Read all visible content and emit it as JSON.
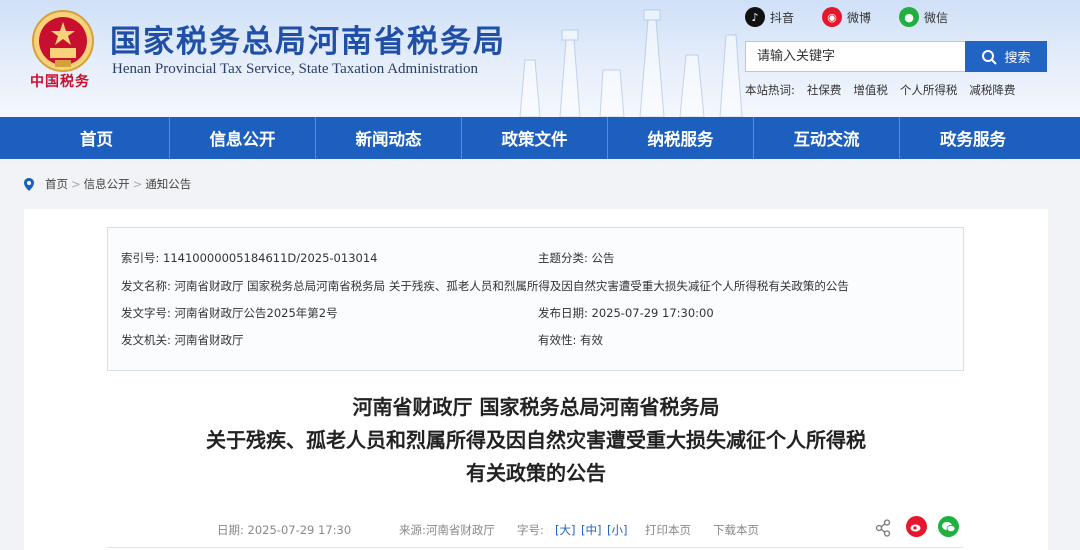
{
  "header": {
    "title_cn": "国家税务总局河南省税务局",
    "title_en": "Henan Provincial Tax Service, State Taxation Administration",
    "emblem_text": "中国税务",
    "social": {
      "douyin": "抖音",
      "weibo": "微博",
      "wechat": "微信"
    },
    "search": {
      "placeholder": "请输入关键字",
      "button": "搜索"
    },
    "hotwords_label": "本站热词:",
    "hotwords": [
      "社保费",
      "增值税",
      "个人所得税",
      "减税降费"
    ]
  },
  "nav": [
    "首页",
    "信息公开",
    "新闻动态",
    "政策文件",
    "纳税服务",
    "互动交流",
    "政务服务"
  ],
  "breadcrumb": [
    "首页",
    "信息公开",
    "通知公告"
  ],
  "meta": {
    "index_no": "索引号: 11410000005184611D/2025-013014",
    "category": "主题分类: 公告",
    "doc_name": "发文名称: 河南省财政厅 国家税务总局河南省税务局 关于残疾、孤老人员和烈属所得及因自然灾害遭受重大损失减征个人所得税有关政策的公告",
    "doc_no": "发文字号: 河南省财政厅公告2025年第2号",
    "pub_date": "发布日期: 2025-07-29 17:30:00",
    "issuer": "发文机关: 河南省财政厅",
    "validity": "有效性: 有效"
  },
  "doc_title": [
    "河南省财政厅 国家税务总局河南省税务局",
    "关于残疾、孤老人员和烈属所得及因自然灾害遭受重大损失减征个人所得税",
    "有关政策的公告"
  ],
  "info_bar": {
    "date": "日期: 2025-07-29 17:30",
    "source": "来源:河南省财政厅",
    "font_label": "字号:",
    "font_large": "[大]",
    "font_medium": "[中]",
    "font_small": "[小]",
    "print": "打印本页",
    "download": "下载本页"
  },
  "colors": {
    "brand_blue": "#1d5fbe",
    "title_blue": "#1f4fa6",
    "weibo_red": "#e6162d",
    "wechat_green": "#20b040"
  }
}
